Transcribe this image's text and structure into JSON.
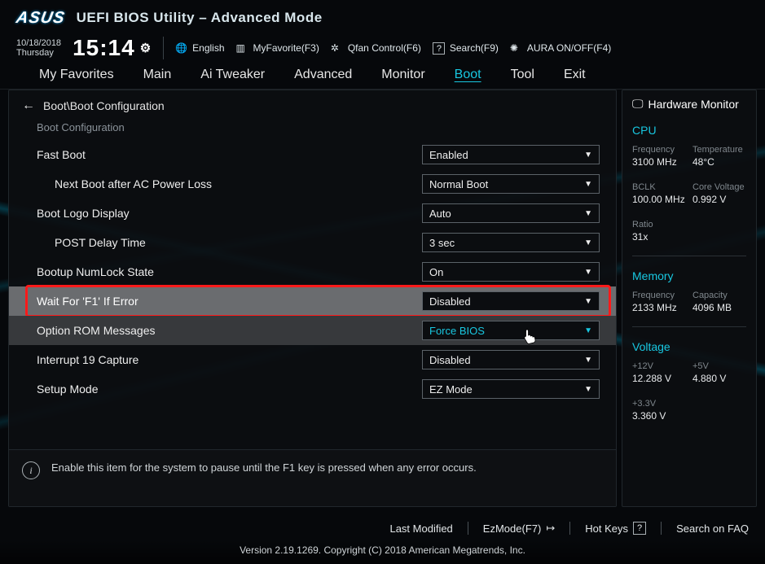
{
  "header": {
    "brand": "ASUS",
    "title": "UEFI BIOS Utility – Advanced Mode",
    "date": "10/18/2018",
    "day": "Thursday",
    "time": "15:14",
    "language_label": "English",
    "myfavorite_label": "MyFavorite(F3)",
    "qfan_label": "Qfan Control(F6)",
    "search_label": "Search(F9)",
    "aura_label": "AURA ON/OFF(F4)"
  },
  "tabs": {
    "items": [
      "My Favorites",
      "Main",
      "Ai Tweaker",
      "Advanced",
      "Monitor",
      "Boot",
      "Tool",
      "Exit"
    ],
    "active": "Boot"
  },
  "breadcrumb": "Boot\\Boot Configuration",
  "section_title": "Boot Configuration",
  "settings": [
    {
      "label": "Fast Boot",
      "value": "Enabled",
      "indent": false
    },
    {
      "label": "Next Boot after AC Power Loss",
      "value": "Normal Boot",
      "indent": true
    },
    {
      "label": "Boot Logo Display",
      "value": "Auto",
      "indent": false
    },
    {
      "label": "POST Delay Time",
      "value": "3 sec",
      "indent": true
    },
    {
      "label": "Bootup NumLock State",
      "value": "On",
      "indent": false
    },
    {
      "label": "Wait For 'F1' If Error",
      "value": "Disabled",
      "indent": false,
      "highlighted": true,
      "redbox": true
    },
    {
      "label": "Option ROM Messages",
      "value": "Force BIOS",
      "indent": false,
      "focused": true
    },
    {
      "label": "Interrupt 19 Capture",
      "value": "Disabled",
      "indent": false
    },
    {
      "label": "Setup Mode",
      "value": "EZ Mode",
      "indent": false
    }
  ],
  "help_text": "Enable this item for the system to pause until the F1 key is pressed when any error occurs.",
  "sidebar": {
    "title": "Hardware Monitor",
    "cpu": {
      "heading": "CPU",
      "frequency_k": "Frequency",
      "frequency_v": "3100 MHz",
      "temp_k": "Temperature",
      "temp_v": "48°C",
      "bclk_k": "BCLK",
      "bclk_v": "100.00 MHz",
      "corev_k": "Core Voltage",
      "corev_v": "0.992 V",
      "ratio_k": "Ratio",
      "ratio_v": "31x"
    },
    "memory": {
      "heading": "Memory",
      "freq_k": "Frequency",
      "freq_v": "2133 MHz",
      "cap_k": "Capacity",
      "cap_v": "4096 MB"
    },
    "voltage": {
      "heading": "Voltage",
      "v12_k": "+12V",
      "v12_v": "12.288 V",
      "v5_k": "+5V",
      "v5_v": "4.880 V",
      "v33_k": "+3.3V",
      "v33_v": "3.360 V"
    }
  },
  "footer": {
    "last_modified": "Last Modified",
    "ezmode": "EzMode(F7)",
    "hotkeys": "Hot Keys",
    "search_faq": "Search on FAQ",
    "version": "Version 2.19.1269. Copyright (C) 2018 American Megatrends, Inc."
  }
}
